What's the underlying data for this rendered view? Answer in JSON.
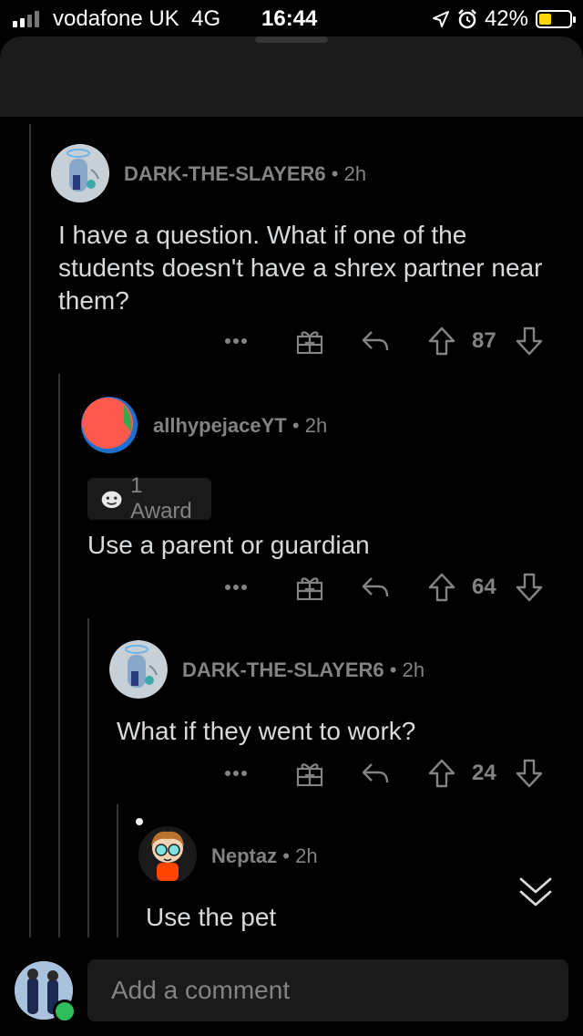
{
  "status_bar": {
    "carrier": "vodafone UK",
    "network": "4G",
    "time": "16:44",
    "battery": "42%",
    "battery_level": 0.42
  },
  "comments": [
    {
      "username": "DARK-THE-SLAYER6",
      "age": "2h",
      "body": "I have a question. What if one of the students doesn't have a shrex partner near them?",
      "score": "87"
    },
    {
      "username": "allhypejaceYT",
      "age": "2h",
      "award": "1 Award",
      "body": "Use a parent or guardian",
      "score": "64"
    },
    {
      "username": "DARK-THE-SLAYER6",
      "age": "2h",
      "body": "What if they went to work?",
      "score": "24"
    },
    {
      "username": "Neptaz",
      "age": "2h",
      "body": "Use the pet"
    }
  ],
  "composer": {
    "placeholder": "Add a comment"
  },
  "colors": {
    "background": "#000000",
    "surface": "#1a1a1b",
    "text": "#d7dadc",
    "muted": "#818384",
    "battery": "#ffd60a",
    "online": "#2ebd59"
  }
}
